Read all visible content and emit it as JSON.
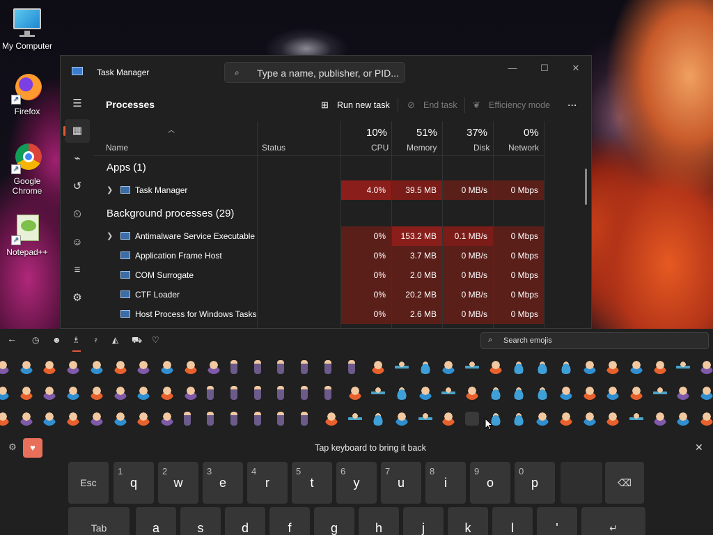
{
  "desktop": {
    "icons": [
      {
        "label": "My Computer",
        "icon": "monitor-icon"
      },
      {
        "label": "Firefox",
        "icon": "firefox-icon"
      },
      {
        "label": "Google Chrome",
        "icon": "chrome-icon"
      },
      {
        "label": "Notepad++",
        "icon": "notepadpp-icon"
      }
    ]
  },
  "task_manager": {
    "title": "Task Manager",
    "search_placeholder": "Type a name, publisher, or PID...",
    "page_heading": "Processes",
    "toolbar": {
      "run_new_task": "Run new task",
      "end_task": "End task",
      "efficiency_mode": "Efficiency mode",
      "more": "..."
    },
    "columns": {
      "name": "Name",
      "status": "Status",
      "cpu": {
        "pct": "10%",
        "label": "CPU"
      },
      "memory": {
        "pct": "51%",
        "label": "Memory"
      },
      "disk": {
        "pct": "37%",
        "label": "Disk"
      },
      "network": {
        "pct": "0%",
        "label": "Network"
      }
    },
    "groups": {
      "apps": "Apps (1)",
      "background": "Background processes (29)"
    },
    "rows": [
      {
        "name": "Task Manager",
        "cpu": "4.0%",
        "memory": "39.5 MB",
        "disk": "0 MB/s",
        "network": "0 Mbps",
        "expandable": true
      },
      {
        "name": "Antimalware Service Executable",
        "cpu": "0%",
        "memory": "153.2 MB",
        "disk": "0.1 MB/s",
        "network": "0 Mbps",
        "expandable": true
      },
      {
        "name": "Application Frame Host",
        "cpu": "0%",
        "memory": "3.7 MB",
        "disk": "0 MB/s",
        "network": "0 Mbps",
        "expandable": false
      },
      {
        "name": "COM Surrogate",
        "cpu": "0%",
        "memory": "2.0 MB",
        "disk": "0 MB/s",
        "network": "0 Mbps",
        "expandable": false
      },
      {
        "name": "CTF Loader",
        "cpu": "0%",
        "memory": "20.2 MB",
        "disk": "0 MB/s",
        "network": "0 Mbps",
        "expandable": false
      },
      {
        "name": "Host Process for Windows Tasks",
        "cpu": "0%",
        "memory": "2.6 MB",
        "disk": "0 MB/s",
        "network": "0 Mbps",
        "expandable": false
      }
    ]
  },
  "emoji_panel": {
    "search_placeholder": "Search emojis",
    "hint": "Tap keyboard to bring it back",
    "categories": [
      "back-icon",
      "recent-icon",
      "smiley-icon",
      "people-icon",
      "celebration-icon",
      "food-icon",
      "travel-icon",
      "heart-icon"
    ],
    "active_category": "people-icon"
  },
  "keyboard": {
    "row1": [
      {
        "label": "Esc",
        "num": ""
      },
      {
        "label": "q",
        "num": "1"
      },
      {
        "label": "w",
        "num": "2"
      },
      {
        "label": "e",
        "num": "3"
      },
      {
        "label": "r",
        "num": "4"
      },
      {
        "label": "t",
        "num": "5"
      },
      {
        "label": "y",
        "num": "6"
      },
      {
        "label": "u",
        "num": "7"
      },
      {
        "label": "i",
        "num": "8"
      },
      {
        "label": "o",
        "num": "9"
      },
      {
        "label": "p",
        "num": "0"
      },
      {
        "label": "",
        "num": ""
      },
      {
        "label": "⌫",
        "num": ""
      }
    ],
    "row2": [
      {
        "label": "Tab",
        "num": ""
      },
      {
        "label": "a",
        "num": ""
      },
      {
        "label": "s",
        "num": ""
      },
      {
        "label": "d",
        "num": ""
      },
      {
        "label": "f",
        "num": ""
      },
      {
        "label": "g",
        "num": ""
      },
      {
        "label": "h",
        "num": ""
      },
      {
        "label": "j",
        "num": ""
      },
      {
        "label": "k",
        "num": ""
      },
      {
        "label": "l",
        "num": ""
      },
      {
        "label": "'",
        "num": ""
      },
      {
        "label": "↵",
        "num": ""
      }
    ]
  }
}
